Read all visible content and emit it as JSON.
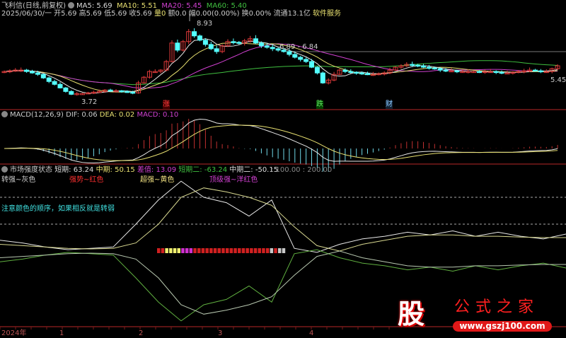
{
  "header": {
    "stock_name": "飞利信(日线,前复权)",
    "ma5": "MA5: 5.69",
    "ma10": "MA10: 5.51",
    "ma20": "MA20: 5.45",
    "ma60": "MA60: 5.40",
    "info_line": "2025/06/30/一 开5.69 高5.69 低5.69 收5.69",
    "vol": "量0",
    "info_line2": "额0.0 幅0.00(0.00%) 换0.00% 流通13.1亿",
    "service": "软件服务"
  },
  "price_labels": {
    "high": "8.93",
    "low": "3.72",
    "range": "6.89 - 6.84",
    "last": "5.45"
  },
  "event_markers": {
    "zhang": "涨",
    "die": "跌",
    "cai": "财"
  },
  "macd_header": {
    "name": "MACD(12,26,9)",
    "dif": "DIF: 0.06",
    "dea": "DEA: 0.02",
    "macd": "MACD: 0.10"
  },
  "strength_header": {
    "name": "市场强度状态",
    "short": "短期: 63.24",
    "mid": "中期: 50.15",
    "diff": "差值: 13.09",
    "short2": "短期二: -63.24",
    "mid2": "中期二: -50.15",
    "levels": ": 100.00 : 200.00",
    "legend_gray": "转强~灰色",
    "legend_red": "强势~红色",
    "legend_yellow": "超强~黄色",
    "legend_magenta": "顶级强~洋红色",
    "note": "注意颜色的顺序，如果相反就是转弱"
  },
  "x_axis": {
    "year": "2024年",
    "months": [
      "1",
      "2",
      "3",
      "4"
    ]
  },
  "watermark": {
    "brand": "股",
    "name": "公式之家",
    "url": "www.gszj100.com"
  },
  "colors": {
    "up": "#e03a3a",
    "down": "#54ffff",
    "ma5": "#e8e8e8",
    "ma10": "#e8e070",
    "ma20": "#d040d0",
    "ma60": "#40c040"
  },
  "chart_data": [
    {
      "type": "candlestick",
      "title": "飞利信(日线,前复权)",
      "closes": [
        5.5,
        5.55,
        5.6,
        5.6,
        5.5,
        5.4,
        5.3,
        5.05,
        4.8,
        4.6,
        4.35,
        4.1,
        3.9,
        3.95,
        3.95,
        4.0,
        4.05,
        4.1,
        4.2,
        4.15,
        4.15,
        4.1,
        4.05,
        4.0,
        4.7,
        5.1,
        5.5,
        5.5,
        5.6,
        6.2,
        7.5,
        7.0,
        7.6,
        8.3,
        8.0,
        7.7,
        7.4,
        7.1,
        6.9,
        7.3,
        7.6,
        7.55,
        7.5,
        7.65,
        7.8,
        7.5,
        7.3,
        7.2,
        7.1,
        7.0,
        6.9,
        6.7,
        6.5,
        6.35,
        6.2,
        5.8,
        5.4,
        4.7,
        4.9,
        5.3,
        5.6,
        5.5,
        5.45,
        5.4,
        5.35,
        5.3,
        5.3,
        5.35,
        5.4,
        5.6,
        5.8,
        5.9,
        6.0,
        5.95,
        5.9,
        5.8,
        5.75,
        5.7,
        5.6,
        5.55,
        5.55,
        5.5,
        5.5,
        5.5,
        5.5,
        5.45,
        5.5,
        5.5,
        5.45,
        5.4,
        5.4,
        5.45,
        5.5,
        5.55,
        5.6,
        5.55,
        5.5,
        5.5,
        5.7,
        5.9
      ],
      "ma_periods": [
        5,
        10,
        20,
        60
      ],
      "ylim": [
        3.5,
        9.2
      ]
    },
    {
      "type": "bar+line",
      "title": "MACD(12,26,9)",
      "derived_from": "closes",
      "params": [
        12,
        26,
        9
      ]
    },
    {
      "type": "line",
      "title": "市场强度状态",
      "series": [
        {
          "name": "短期",
          "values": [
            40,
            30,
            15,
            5,
            10,
            15,
            100,
            190,
            260,
            200,
            180,
            130,
            190,
            10,
            -5,
            25,
            45,
            55,
            70,
            60,
            75,
            55,
            70,
            55,
            45,
            63.24
          ]
        },
        {
          "name": "中期",
          "values": [
            25,
            20,
            15,
            10,
            8,
            10,
            30,
            100,
            200,
            235,
            220,
            200,
            170,
            90,
            20,
            0,
            25,
            40,
            55,
            60,
            60,
            55,
            55,
            52,
            50,
            50.15
          ]
        }
      ],
      "mirrored_series": [
        "短期二",
        "中期二"
      ],
      "reference_levels": [
        100,
        200
      ],
      "state_blocks": [
        "red",
        "red",
        "yellow",
        "yellow",
        "yellow",
        "yellow",
        "magenta",
        "magenta",
        "magenta",
        "red",
        "red",
        "red",
        "red",
        "red",
        "red",
        "red",
        "red",
        "red",
        "red",
        "red",
        "red",
        "red",
        "red",
        "red",
        "red",
        "red",
        "red",
        "red",
        "gray",
        "red",
        "gray",
        "gray"
      ]
    }
  ]
}
